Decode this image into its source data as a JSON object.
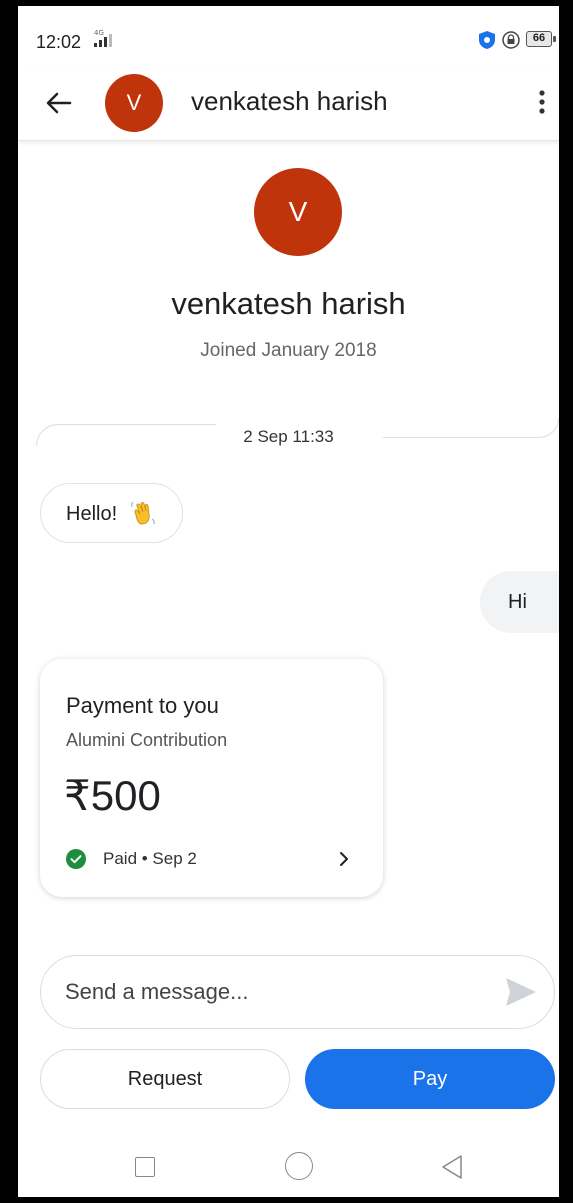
{
  "status_bar": {
    "time": "12:02",
    "network": "4G",
    "battery": "66"
  },
  "header": {
    "avatar_letter": "V",
    "contact_name": "venkatesh harish"
  },
  "profile": {
    "avatar_letter": "V",
    "name": "venkatesh harish",
    "joined": "Joined January 2018"
  },
  "conversation": {
    "timestamp": "2 Sep 11:33",
    "incoming_message": "Hello!",
    "outgoing_message": "Hi"
  },
  "payment": {
    "title": "Payment to you",
    "note": "Alumini Contribution",
    "amount": "₹500",
    "status": "Paid • Sep 2",
    "status_color": "#1e8e3e"
  },
  "composer": {
    "placeholder": "Send a message..."
  },
  "actions": {
    "request_label": "Request",
    "pay_label": "Pay",
    "pay_color": "#1a73e8"
  },
  "colors": {
    "avatar": "#c0340c"
  }
}
